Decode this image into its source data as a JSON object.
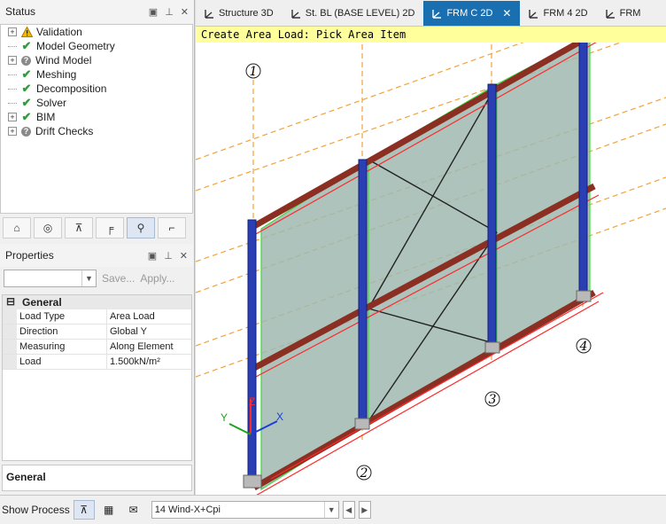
{
  "status_panel": {
    "title": "Status",
    "items": [
      {
        "label": "Validation",
        "state": "warning",
        "expandable": true
      },
      {
        "label": "Model Geometry",
        "state": "ok",
        "expandable": false
      },
      {
        "label": "Wind Model",
        "state": "unknown",
        "expandable": true
      },
      {
        "label": "Meshing",
        "state": "ok",
        "expandable": false
      },
      {
        "label": "Decomposition",
        "state": "ok",
        "expandable": false
      },
      {
        "label": "Solver",
        "state": "ok",
        "expandable": false
      },
      {
        "label": "BIM",
        "state": "ok",
        "expandable": true
      },
      {
        "label": "Drift Checks",
        "state": "unknown",
        "expandable": true
      }
    ]
  },
  "properties_panel": {
    "title": "Properties",
    "save_label": "Save...",
    "apply_label": "Apply...",
    "category": "General",
    "rows": [
      {
        "key": "Load Type",
        "value": "Area Load"
      },
      {
        "key": "Direction",
        "value": "Global Y"
      },
      {
        "key": "Measuring",
        "value": "Along Element"
      },
      {
        "key": "Load",
        "value": "1.500kN/m²"
      }
    ],
    "footer_title": "General"
  },
  "tabs": [
    {
      "label": "Structure 3D",
      "active": false
    },
    {
      "label": "St. BL (BASE LEVEL) 2D",
      "active": false
    },
    {
      "label": "FRM C 2D",
      "active": true
    },
    {
      "label": "FRM 4 2D",
      "active": false
    },
    {
      "label": "FRM",
      "active": false
    }
  ],
  "viewport": {
    "hint": "Create Area Load: Pick Area Item",
    "grid_labels": [
      "1",
      "2",
      "3",
      "4"
    ],
    "axis_labels": {
      "x": "X",
      "y": "Y",
      "z": "Z"
    }
  },
  "bottom_bar": {
    "show_process_label": "Show Process",
    "load_case": "14 Wind-X+Cpi"
  },
  "colors": {
    "accent": "#1a6fb0",
    "hint_bg": "#ffff9c",
    "panel_fill": "#9fb8b0",
    "column": "#2a3fb3",
    "beam": "#8b2f23",
    "highlight_red": "#ff2a2a",
    "highlight_green": "#3ed93e",
    "gridline": "#f2a23a"
  }
}
